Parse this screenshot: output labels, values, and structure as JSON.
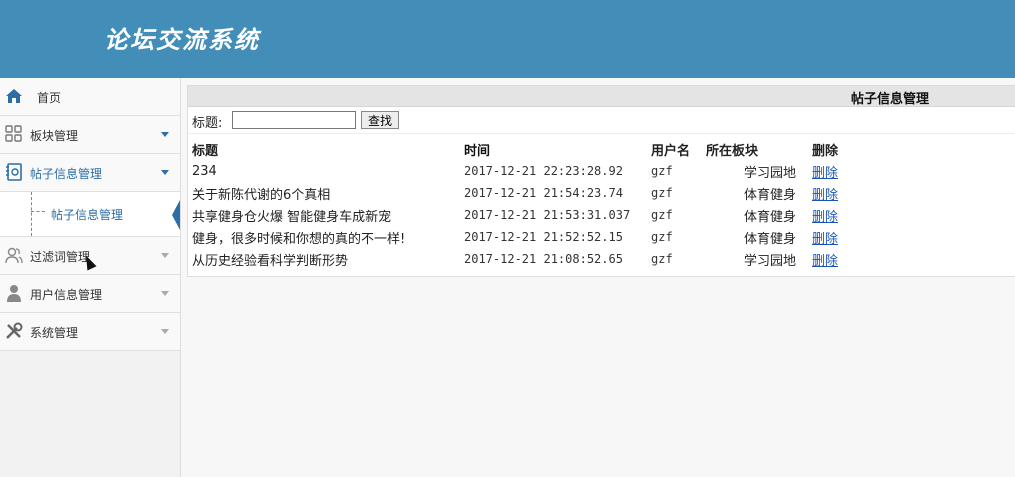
{
  "header": {
    "brand": "论坛交流系统",
    "accent": "#438eb9"
  },
  "sidebar": {
    "items": [
      {
        "label": "首页",
        "icon": "home-icon"
      },
      {
        "label": "板块管理",
        "icon": "grid-icon"
      },
      {
        "label": "帖子信息管理",
        "icon": "post-book-icon"
      },
      {
        "label": "过滤词管理",
        "icon": "users-icon"
      },
      {
        "label": "用户信息管理",
        "icon": "user-icon"
      },
      {
        "label": "系统管理",
        "icon": "tools-icon"
      }
    ],
    "sub_item": {
      "label": "帖子信息管理"
    }
  },
  "main": {
    "title": "帖子信息管理",
    "search": {
      "label": "标题:",
      "value": "",
      "button": "查找"
    },
    "columns": {
      "title": "标题",
      "time": "时间",
      "user": "用户名",
      "board": "所在板块",
      "delete": "删除"
    },
    "rows": [
      {
        "title": "234",
        "time": "2017-12-21 22:23:28.92",
        "user": "gzf",
        "board": "学习园地",
        "delete": "删除"
      },
      {
        "title": "关于新陈代谢的6个真相",
        "time": "2017-12-21 21:54:23.74",
        "user": "gzf",
        "board": "体育健身",
        "delete": "删除"
      },
      {
        "title": "共享健身仓火爆 智能健身车成新宠",
        "time": "2017-12-21 21:53:31.037",
        "user": "gzf",
        "board": "体育健身",
        "delete": "删除"
      },
      {
        "title": "健身，很多时候和你想的真的不一样!",
        "time": "2017-12-21 21:52:52.15",
        "user": "gzf",
        "board": "体育健身",
        "delete": "删除"
      },
      {
        "title": "从历史经验看科学判断形势",
        "time": "2017-12-21 21:08:52.65",
        "user": "gzf",
        "board": "学习园地",
        "delete": "删除"
      }
    ]
  }
}
